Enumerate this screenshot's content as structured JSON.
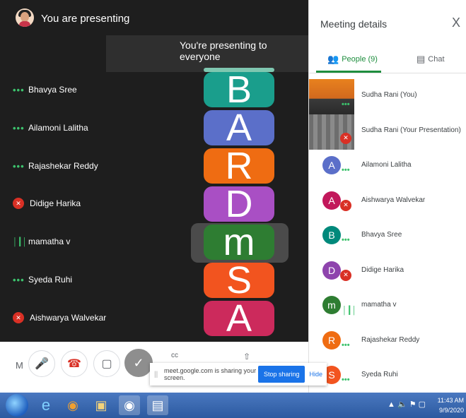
{
  "window": {
    "presenting_title": "You are presenting",
    "banner": "You're presenting to everyone"
  },
  "participants_overlay": [
    {
      "name": "Bhavya Sree",
      "status": "dots"
    },
    {
      "name": "Ailamoni Lalitha",
      "status": "dots"
    },
    {
      "name": "Rajashekar Reddy",
      "status": "dots"
    },
    {
      "name": "Didige Harika",
      "status": "muted"
    },
    {
      "name": "mamatha v",
      "status": "speaking"
    },
    {
      "name": "Syeda Ruhi",
      "status": "dots"
    },
    {
      "name": "Aishwarya Walvekar",
      "status": "muted"
    }
  ],
  "presentation": {
    "letters": [
      {
        "char": "B",
        "color": "#1a9e8c"
      },
      {
        "char": "A",
        "color": "#5b6fc9"
      },
      {
        "char": "R",
        "color": "#ef6c12"
      },
      {
        "char": "D",
        "color": "#a94fc4"
      },
      {
        "char": "m",
        "color": "#2e7d32"
      },
      {
        "char": "S",
        "color": "#f2541f"
      },
      {
        "char": "A",
        "color": "#cc2a5c"
      }
    ]
  },
  "controls": {
    "m_label": "M",
    "cc_label": "cc"
  },
  "share_toast": {
    "message": "meet.google.com is sharing your screen.",
    "stop_label": "Stop sharing",
    "hide_label": "Hide"
  },
  "panel": {
    "title": "Meeting details",
    "close": "X",
    "tab_people": "People (9)",
    "tab_chat": "Chat",
    "people": [
      {
        "name": "Sudha Rani (You)",
        "kind": "thumb1",
        "status": "dots"
      },
      {
        "name": "Sudha Rani (Your Presentation)",
        "kind": "thumb2",
        "status": "muted"
      },
      {
        "name": "Ailamoni Lalitha",
        "initial": "A",
        "color": "#5b6fc9",
        "status": "dots"
      },
      {
        "name": "Aishwarya Walvekar",
        "initial": "A",
        "color": "#c2185b",
        "status": "muted"
      },
      {
        "name": "Bhavya Sree",
        "initial": "B",
        "color": "#00897b",
        "status": "dots"
      },
      {
        "name": "Didige Harika",
        "initial": "D",
        "color": "#8e44ad",
        "status": "muted"
      },
      {
        "name": "mamatha v",
        "initial": "m",
        "color": "#2e7d32",
        "status": "speaking"
      },
      {
        "name": "Rajashekar Reddy",
        "initial": "R",
        "color": "#ef6c12",
        "status": "dots"
      },
      {
        "name": "Syeda Ruhi",
        "initial": "S",
        "color": "#f2541f",
        "status": "dots"
      }
    ]
  },
  "taskbar": {
    "time": "11:43 AM",
    "date": "9/9/2020"
  }
}
